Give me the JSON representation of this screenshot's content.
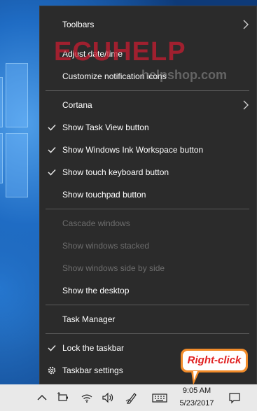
{
  "menu": {
    "items": [
      {
        "label": "Toolbars",
        "checked": false,
        "disabled": false,
        "submenu": true
      },
      {
        "label": "Adjust date/time",
        "checked": false,
        "disabled": false,
        "submenu": false
      },
      {
        "label": "Customize notification icons",
        "checked": false,
        "disabled": false,
        "submenu": false
      },
      {
        "label": "Cortana",
        "checked": false,
        "disabled": false,
        "submenu": true
      },
      {
        "label": "Show Task View button",
        "checked": true,
        "disabled": false,
        "submenu": false
      },
      {
        "label": "Show Windows Ink Workspace button",
        "checked": true,
        "disabled": false,
        "submenu": false
      },
      {
        "label": "Show touch keyboard button",
        "checked": true,
        "disabled": false,
        "submenu": false
      },
      {
        "label": "Show touchpad button",
        "checked": false,
        "disabled": false,
        "submenu": false
      },
      {
        "label": "Cascade windows",
        "checked": false,
        "disabled": true,
        "submenu": false
      },
      {
        "label": "Show windows stacked",
        "checked": false,
        "disabled": true,
        "submenu": false
      },
      {
        "label": "Show windows side by side",
        "checked": false,
        "disabled": true,
        "submenu": false
      },
      {
        "label": "Show the desktop",
        "checked": false,
        "disabled": false,
        "submenu": false
      },
      {
        "label": "Task Manager",
        "checked": false,
        "disabled": false,
        "submenu": false
      },
      {
        "label": "Lock the taskbar",
        "checked": true,
        "disabled": false,
        "submenu": false
      },
      {
        "label": "Taskbar settings",
        "checked": false,
        "disabled": false,
        "submenu": false,
        "icon": "gear-icon"
      }
    ]
  },
  "watermark": {
    "brand": "ECUHELP",
    "site": "helpshop.com"
  },
  "callout": {
    "text": "Right-click"
  },
  "taskbar": {
    "time": "9:05 AM",
    "date": "5/23/2017",
    "icons": [
      "chevron-up-icon",
      "battery-plug-icon",
      "wifi-icon",
      "volume-icon",
      "pen-icon",
      "keyboard-icon",
      "notification-icon"
    ]
  },
  "colors": {
    "menu_bg": "#2b2b2b",
    "menu_text": "#ffffff",
    "menu_disabled_text": "#6d6d6d",
    "separator": "#5a5a5a",
    "taskbar_bg": "#e9e9e9",
    "callout_border": "#f28c2a",
    "callout_text": "#e02020"
  }
}
